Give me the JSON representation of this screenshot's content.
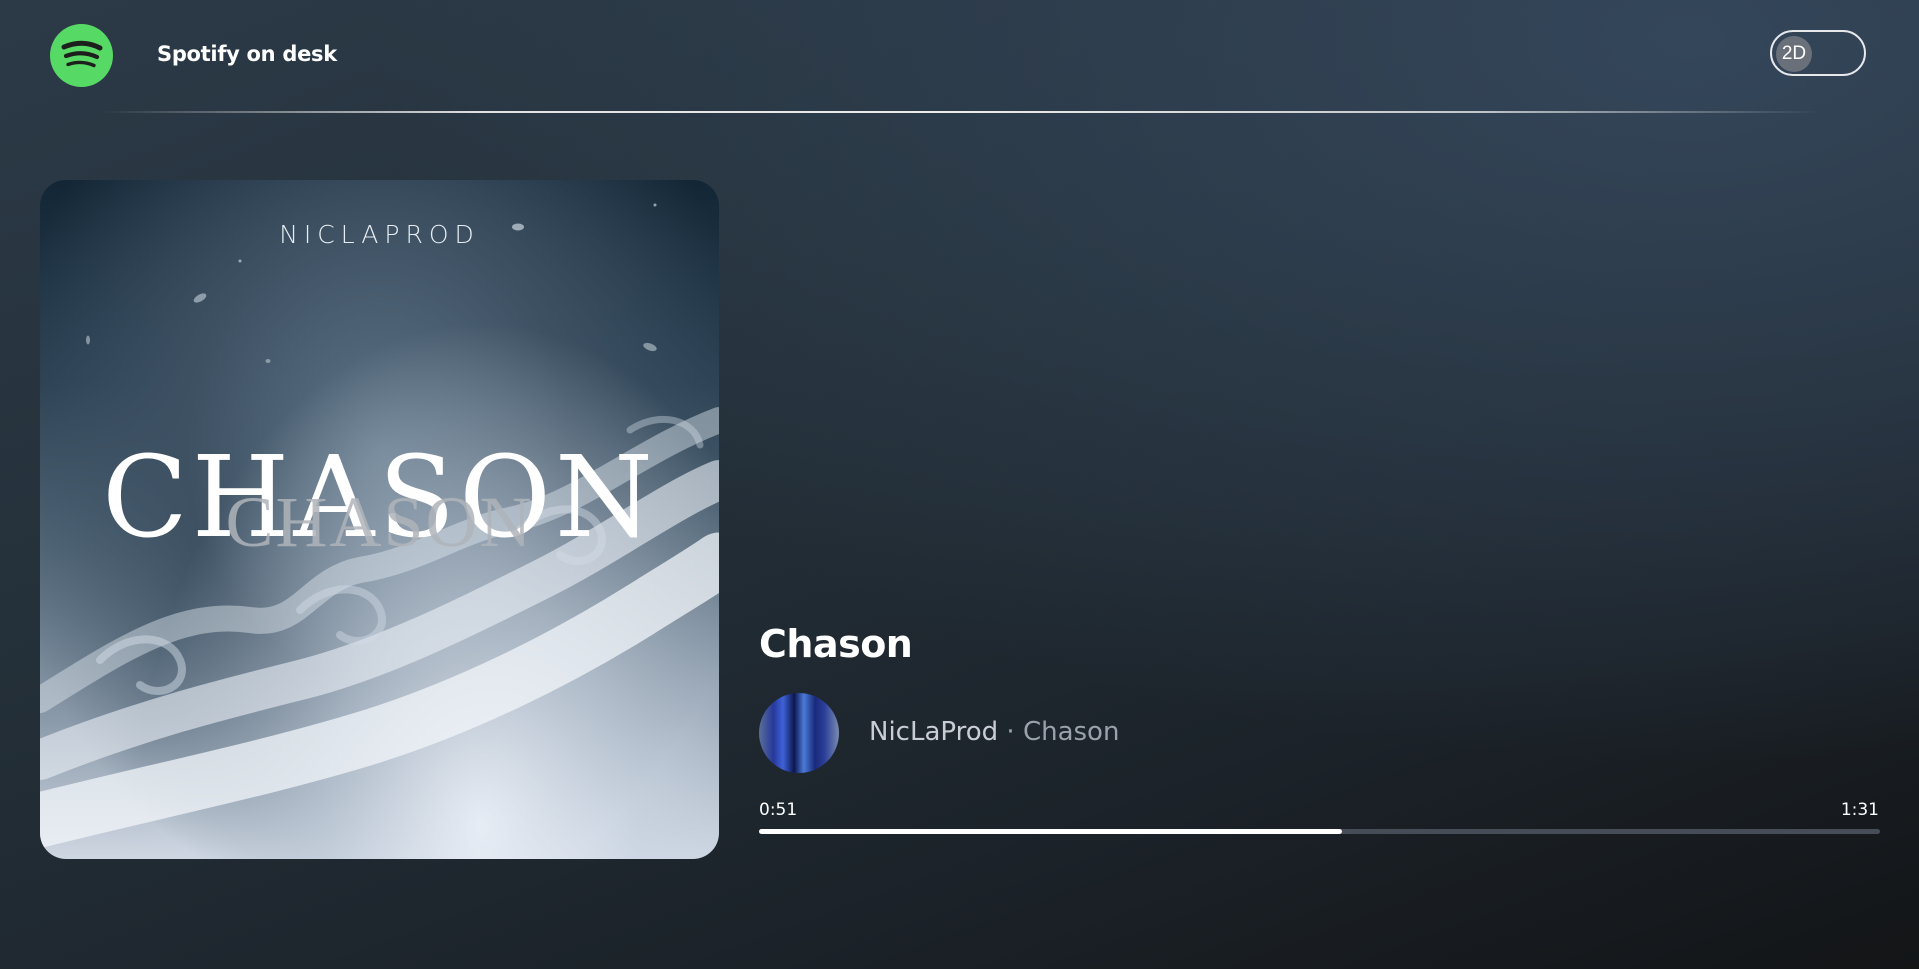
{
  "header": {
    "app_title": "Spotify on desk",
    "logo_icon": "spotify-logo-icon",
    "mode_toggle_label": "2D",
    "accent_color": "#1ed760"
  },
  "album_art": {
    "cover_artist_text": "NICLAPROD",
    "cover_title_text": "CHASON",
    "cover_title_ghost_text": "CHASON"
  },
  "track": {
    "title": "Chason",
    "artist": "NicLaProd",
    "separator": " · ",
    "album": "Chason"
  },
  "playback": {
    "elapsed": "0:51",
    "duration": "1:31",
    "progress_fraction": 0.52
  }
}
